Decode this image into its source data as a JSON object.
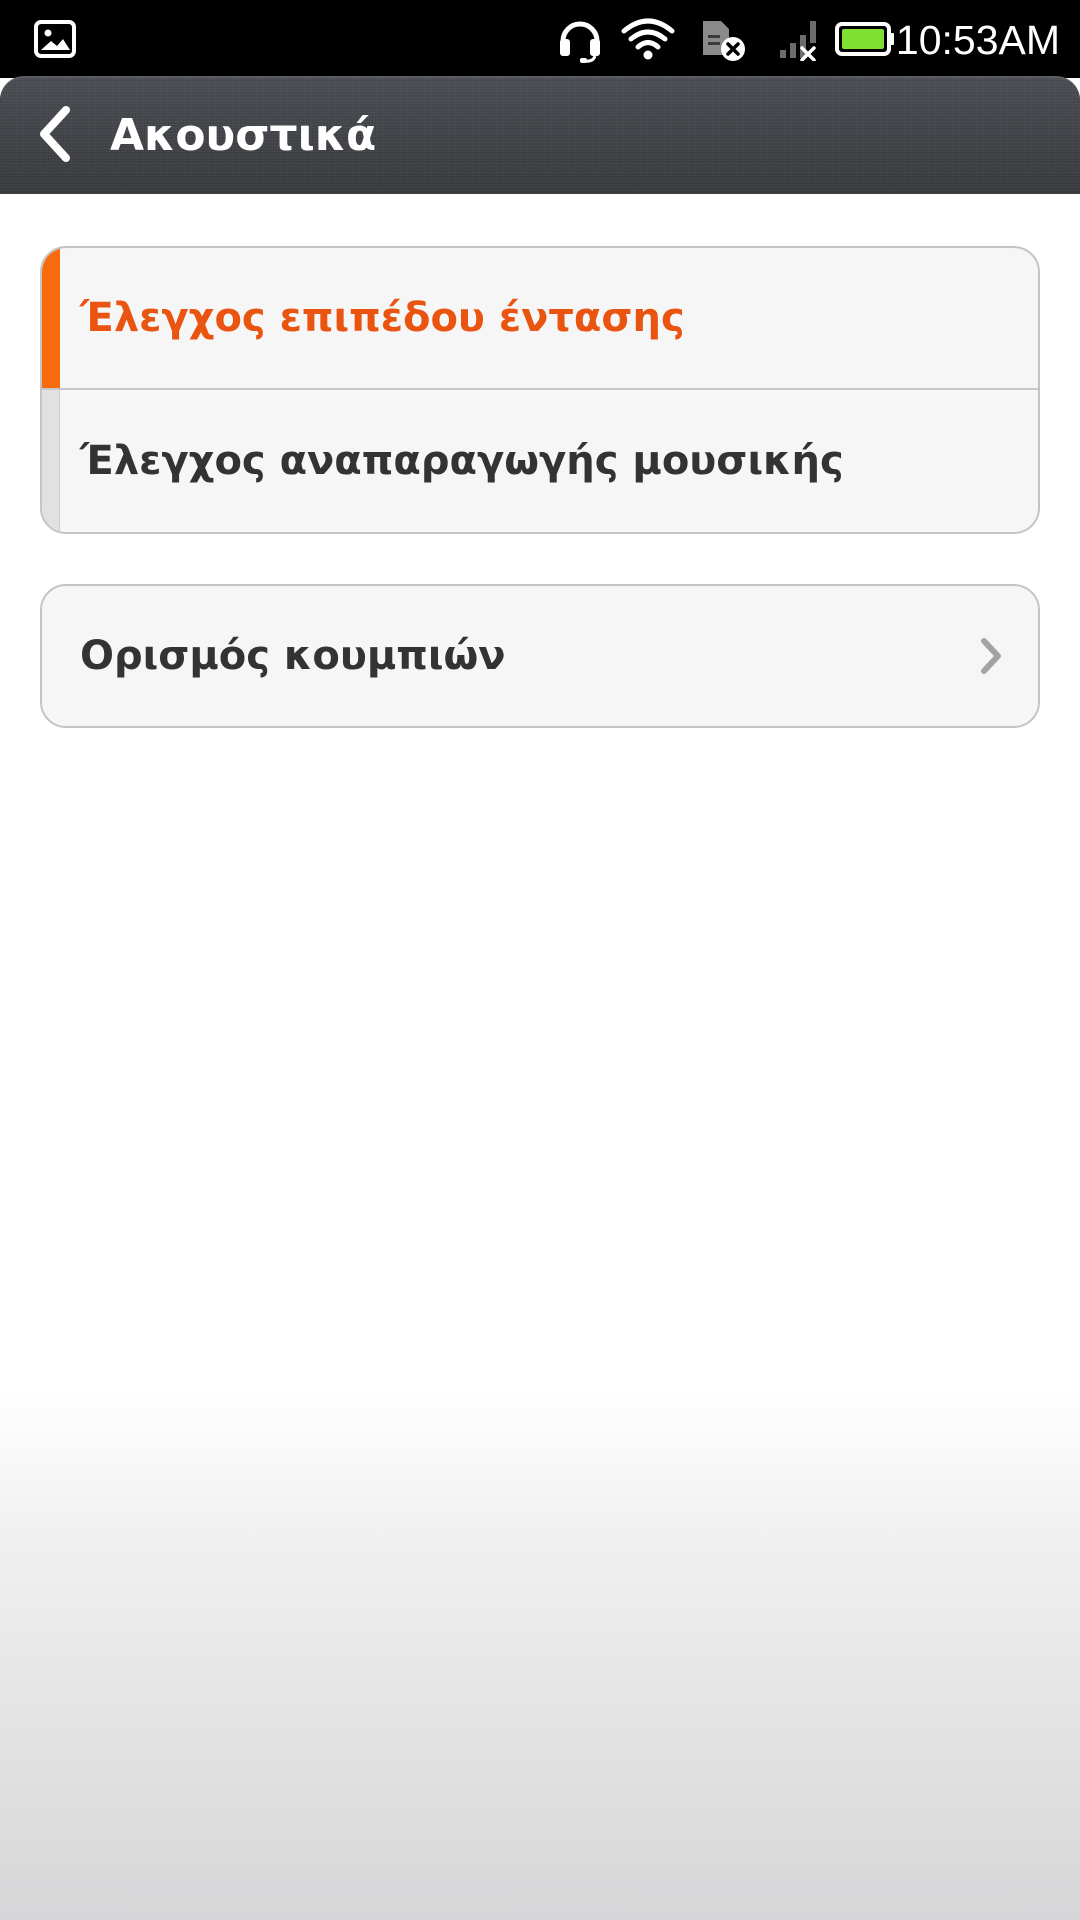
{
  "status_bar": {
    "time": "10:53AM",
    "icons": [
      "image-notification-icon",
      "headset-icon",
      "wifi-icon",
      "sim-error-icon",
      "no-signal-icon",
      "battery-icon"
    ],
    "battery_color": "#7fe032"
  },
  "header": {
    "title": "Ακουστικά"
  },
  "groups": [
    {
      "items": [
        {
          "label": "Έλεγχος επιπέδου έντασης",
          "selected": true
        },
        {
          "label": "Έλεγχος αναπαραγωγής μουσικής",
          "selected": false
        }
      ]
    },
    {
      "items": [
        {
          "label": "Ορισμός κουμπιών",
          "has_chevron": true
        }
      ]
    }
  ],
  "colors": {
    "accent": "#f76a0d",
    "accent_text": "#e95510",
    "header_bg": "#3b3d41",
    "status_bar_bg": "#000000"
  }
}
